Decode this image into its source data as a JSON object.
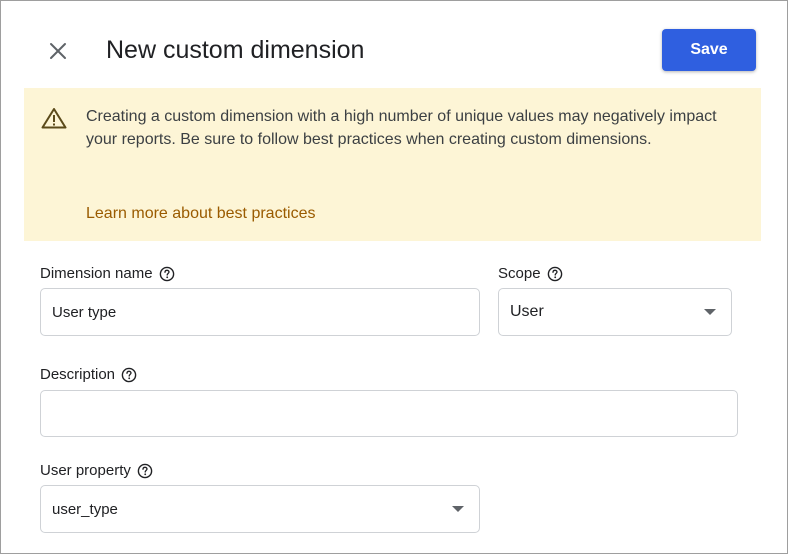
{
  "dialog": {
    "title": "New custom dimension",
    "close_icon": "close-icon",
    "save_label": "Save"
  },
  "warning": {
    "icon": "warning-triangle-icon",
    "text": "Creating a custom dimension with a high number of unique values may negatively impact your reports. Be sure to follow best practices when creating custom dimensions.",
    "link_label": "Learn more about best practices"
  },
  "form": {
    "dimension_name": {
      "label": "Dimension name",
      "value": "User type",
      "help_icon": "help-circle-icon"
    },
    "scope": {
      "label": "Scope",
      "value": "User",
      "help_icon": "help-circle-icon"
    },
    "description": {
      "label": "Description",
      "value": "",
      "help_icon": "help-circle-icon"
    },
    "user_property": {
      "label": "User property",
      "value": "user_type",
      "help_icon": "help-circle-icon"
    }
  },
  "colors": {
    "save_button": "#2f5fe0",
    "banner_background": "#fdf5d6",
    "link": "#9a5b00",
    "text": "#202124"
  }
}
